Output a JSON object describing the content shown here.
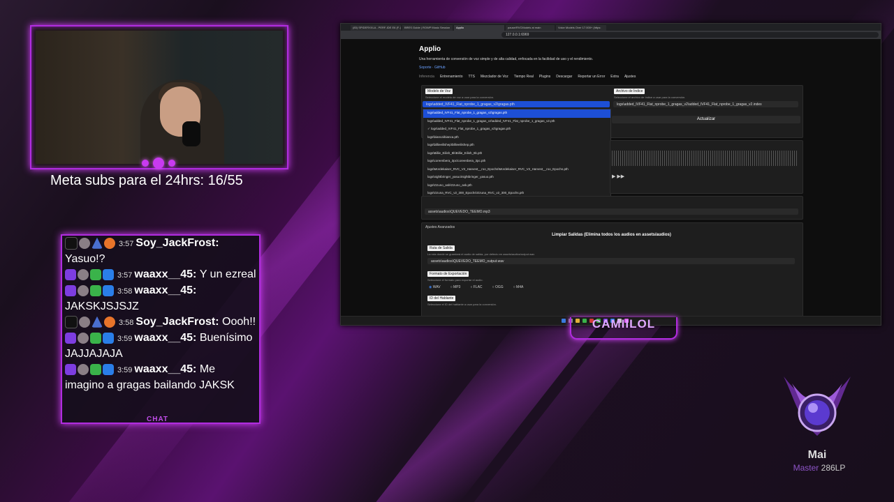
{
  "overlay": {
    "goal_text": "Meta subs para el 24hrs: 16/55",
    "chat_label": "CHAT",
    "streamer_name": "CAMIILOL",
    "rank": {
      "player": "Mai",
      "tier": "Master",
      "lp": "286LP"
    }
  },
  "chat": [
    {
      "time": "3:57",
      "user": "Soy_JackFrost:",
      "text": "Yasuo!?",
      "badges": [
        "tiktok",
        "avatar",
        "tri",
        "heart"
      ]
    },
    {
      "time": "3:57",
      "user": "waaxx__45:",
      "text": "Y un ezreal",
      "badges": [
        "twitch",
        "avatar",
        "sword",
        "blue"
      ]
    },
    {
      "time": "3:58",
      "user": "waaxx__45:",
      "text": "JAKSKJSJSJZ",
      "badges": [
        "twitch",
        "avatar",
        "sword",
        "blue"
      ]
    },
    {
      "time": "3:58",
      "user": "Soy_JackFrost:",
      "text": "Oooh!!",
      "badges": [
        "tiktok",
        "avatar",
        "tri",
        "heart"
      ]
    },
    {
      "time": "3:59",
      "user": "waaxx__45:",
      "text": "Buenísimo JAJJAJAJA",
      "badges": [
        "twitch",
        "avatar",
        "sword",
        "blue"
      ]
    },
    {
      "time": "3:59",
      "user": "waaxx__45:",
      "text": "Me imagino a gragas bailando JAKSK",
      "badges": [
        "twitch",
        "avatar",
        "sword",
        "blue"
      ]
    }
  ],
  "browser": {
    "tabs": [
      "(83) SPIDERXXLA - PERF-IDE E6 (F..)",
      "BRES Guide | ROWP Music Session",
      "Applio",
      "pause/RVCModels at main",
      "Voice Models Over 17.000+ (https:"
    ],
    "url": "127.0.0.1:6969",
    "app": {
      "title": "Applio",
      "description": "Una herramienta de conversión de voz simple y de alta calidad, enfocada en la facilidad de uso y el rendimiento.",
      "links": [
        "Soporte",
        "GitHub"
      ],
      "nav": [
        "Inferencia",
        "Entrenamiento",
        "TTS",
        "Mezclador de Voz",
        "Tiempo Real",
        "Plugins",
        "Descargar",
        "Reportar un Error",
        "Extra",
        "Ajustes"
      ],
      "voice_model_label": "Modelo de Voz",
      "voice_model_hint": "Seleccione el modelo de voz a usar para la conversión.",
      "voice_model_value": "logs\\added_IVF41_Flat_nprobe_1_gragas_v2\\gragas.pth",
      "index_label": "Archivo de Índice",
      "index_hint": "Seleccione el archivo de índice a usar para la conversión.",
      "index_value": "logs\\added_IVF41_Flat_nprobe_1_gragas_v2\\added_IVF41_Flat_nprobe_1_gragas_v2.index",
      "update_button": "Actualizar",
      "dropdown_items": [
        "logs\\added_IVF41_Flat_nprobe_1_gragas_v2\\gragas.pth",
        "logs\\added_IVF41_Flat_nprobe_1_gragas_v2\\added_IVF41_Flat_nprobe_1_gragas_v2.pth",
        "✓ logs\\added_IVF41_Flat_nprobe_1_gragas_v2\\gragas.pth",
        "logs\\bianca\\bianca.pth",
        "logs\\billieeilishep\\billieeilishep.pth",
        "logs\\Billie_Eilish_8k\\Billie_Eilish_8k.pth",
        "logs\\coreenbera_3pc\\coreenbera_3pc.pth",
        "logs\\Mordekaiser_RVC_V2_Harvest__roo_Epochs\\Mordekaiser_RVC_V2_Harvest__roo_Epochs.pth",
        "logs\\nightbringer_yasuo\\nightbringer_yasuo.pth",
        "logs\\Ozuno_ask\\Ozuno_ask.pth",
        "logs\\Ozuna_RVC_v2_300_Epochs\\Ozuna_RVC_v2_300_Epochs.pth",
        "logs\\Pantheon-LOL-its-Voice\\Pantheon-LOL-its-Voice.pth",
        "logs\\Teemo\\Teemo.pth"
      ],
      "audio_path": "assets\\audios\\QUEVEDO_TEEMO.mp3",
      "advanced_label": "Ajustes Avanzados",
      "clear_outputs": "Limpiar Salidas (Elimina todos los audios en assets/audios)",
      "output_path_label": "Ruta de Salida",
      "output_path_hint": "La ruta donde se guardará el audio de salida, por defecto en assets/audios/output.wav",
      "output_path_value": "assets\\audios\\QUEVEDO_TEEMO_output.wav",
      "export_format_label": "Formato de Exportación",
      "export_format_hint": "Seleccione el formato para exportar el audio.",
      "formats": [
        "WAV",
        "MP3",
        "FLAC",
        "OGG",
        "M4A"
      ],
      "speaker_label": "ID del Hablante",
      "speaker_hint": "Seleccione el ID del hablante a usar para la conversión."
    }
  }
}
